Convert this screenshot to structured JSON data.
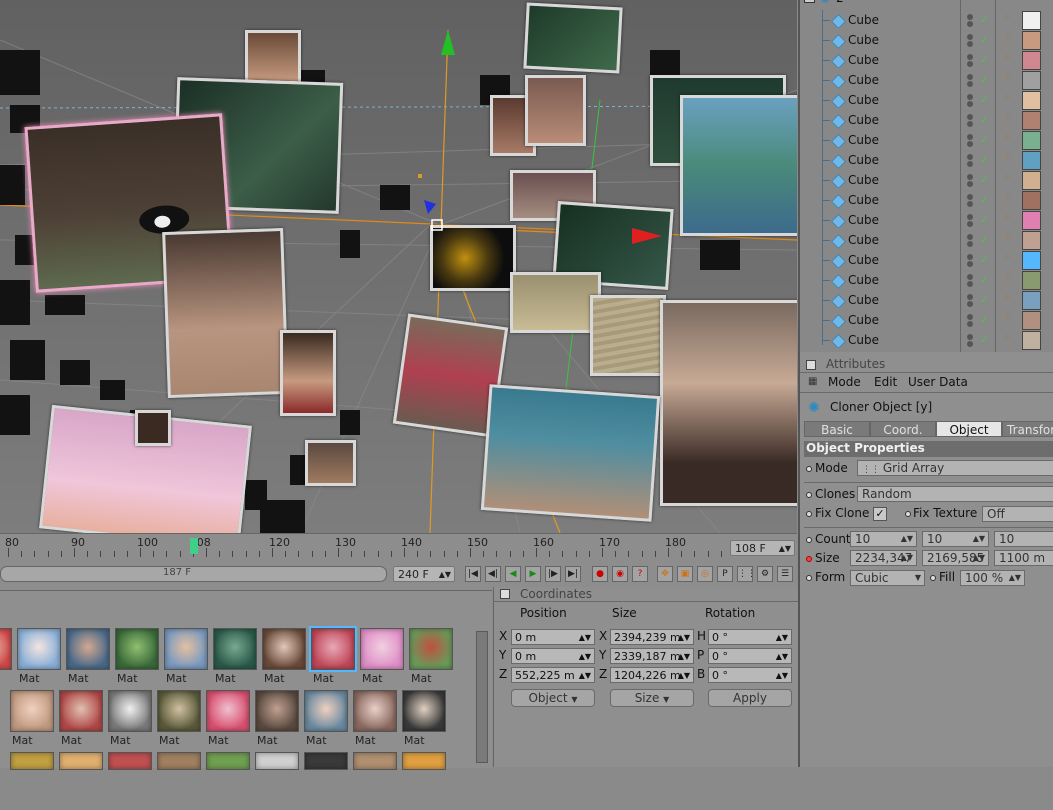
{
  "viewport": {
    "axis_x_color": "#e02020",
    "axis_y_color": "#20c020",
    "axis_z_color": "#2030e0"
  },
  "timeline": {
    "ruler_labels": [
      "80",
      "90",
      "100",
      "108",
      "120",
      "130",
      "140",
      "150",
      "160",
      "170",
      "180"
    ],
    "current_frame": "108 F",
    "end_frame": "240 F",
    "min_frame": "187 F"
  },
  "materials": {
    "row1": [
      "Mat",
      "Mat",
      "Mat",
      "Mat",
      "Mat",
      "Mat",
      "Mat",
      "Mat",
      "Mat",
      "Mat"
    ],
    "row2": [
      "Mat",
      "Mat",
      "Mat",
      "Mat",
      "Mat",
      "Mat",
      "Mat",
      "Mat",
      "Mat"
    ]
  },
  "coordinates": {
    "title": "Coordinates",
    "headers": {
      "position": "Position",
      "size": "Size",
      "rotation": "Rotation"
    },
    "rows": [
      {
        "axis": "X",
        "pos": "0 m",
        "size_axis": "X",
        "size": "2394,239 m",
        "rot_axis": "H",
        "rot": "0 °"
      },
      {
        "axis": "Y",
        "pos": "0 m",
        "size_axis": "Y",
        "size": "2339,187 m",
        "rot_axis": "P",
        "rot": "0 °"
      },
      {
        "axis": "Z",
        "pos": "552,225 m",
        "size_axis": "Z",
        "size": "1204,226 m",
        "rot_axis": "B",
        "rot": "0 °"
      }
    ],
    "mode_dropdown": "Object",
    "size_dropdown": "Size",
    "apply_label": "Apply"
  },
  "object_manager": {
    "group_label": "2",
    "items": [
      "Cube",
      "Cube",
      "Cube",
      "Cube",
      "Cube",
      "Cube",
      "Cube",
      "Cube",
      "Cube",
      "Cube",
      "Cube",
      "Cube",
      "Cube",
      "Cube",
      "Cube",
      "Cube",
      "Cube"
    ]
  },
  "attributes": {
    "title": "Attributes",
    "menu": [
      "Mode",
      "Edit",
      "User Data"
    ],
    "object_title": "Cloner Object [y]",
    "tabs": [
      "Basic",
      "Coord.",
      "Object",
      "Transform"
    ],
    "active_tab": "Object",
    "section": "Object Properties",
    "mode_label": "Mode",
    "mode_value": "Grid Array",
    "clones_label": "Clones",
    "clones_value": "Random",
    "fix_clone_label": "Fix Clone",
    "fix_texture_label": "Fix Texture",
    "fix_texture_value": "Off",
    "count_label": "Count",
    "count_values": [
      "10",
      "10",
      "10"
    ],
    "size_label": "Size",
    "size_values": [
      "2234,347",
      "2169,585",
      "1100 m"
    ],
    "form_label": "Form",
    "form_value": "Cubic",
    "fill_label": "Fill",
    "fill_value": "100 %"
  }
}
